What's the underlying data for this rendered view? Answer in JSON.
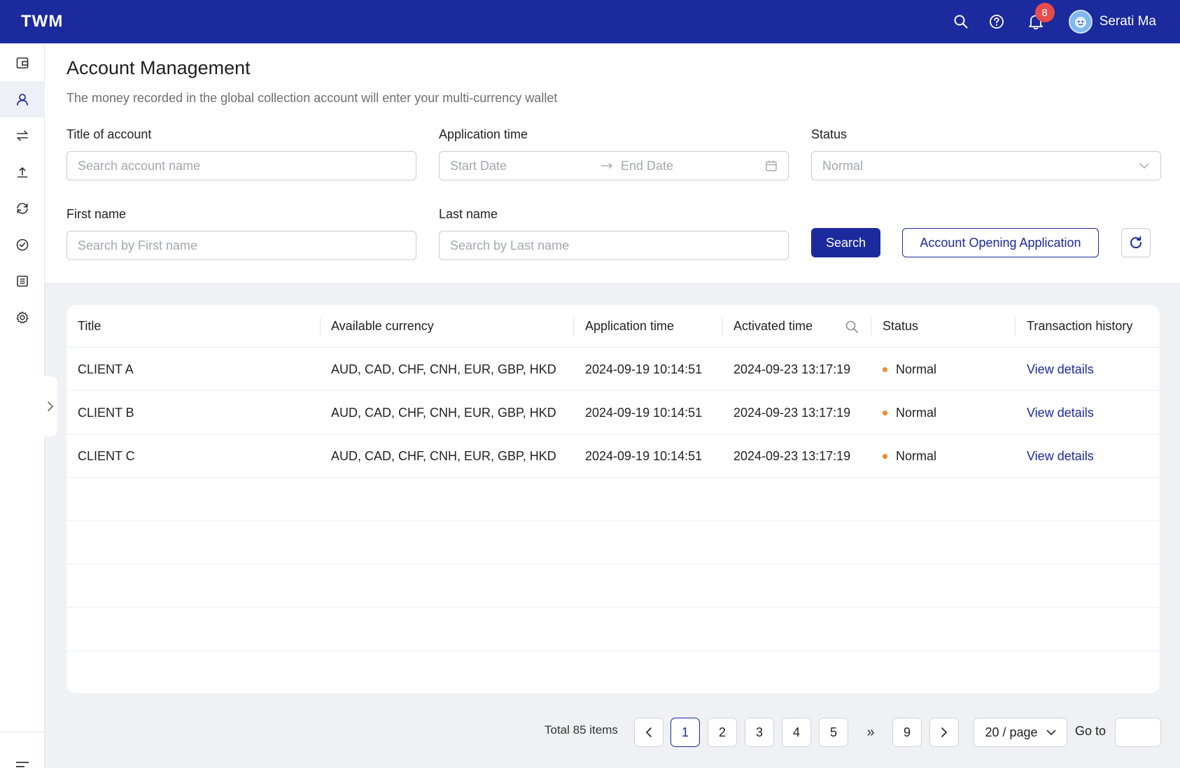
{
  "header": {
    "logo": "TWM",
    "notification_count": "8",
    "user_name": "Serati Ma"
  },
  "sidebar": {
    "items": [
      {
        "icon": "wallet-icon"
      },
      {
        "icon": "user-icon",
        "active": true
      },
      {
        "icon": "transfer-icon"
      },
      {
        "icon": "upload-icon"
      },
      {
        "icon": "refresh-cycle-icon"
      },
      {
        "icon": "check-circle-icon"
      },
      {
        "icon": "list-icon"
      },
      {
        "icon": "gear-icon"
      }
    ]
  },
  "page": {
    "title": "Account Management",
    "subtitle": "The money recorded in the global collection account will enter your multi-currency wallet"
  },
  "filters": {
    "title_label": "Title of account",
    "title_placeholder": "Search account name",
    "app_time_label": "Application time",
    "start_placeholder": "Start Date",
    "end_placeholder": "End Date",
    "status_label": "Status",
    "status_value": "Normal",
    "first_label": "First name",
    "first_placeholder": "Search by First name",
    "last_label": "Last name",
    "last_placeholder": "Search by Last name",
    "search_btn": "Search",
    "open_btn": "Account Opening Application"
  },
  "table": {
    "columns": [
      "Title",
      "Available currency",
      "Application time",
      "Activated time",
      "Status",
      "Transaction history"
    ],
    "rows": [
      {
        "title": "CLIENT A",
        "currency": "AUD, CAD, CHF, CNH, EUR, GBP, HKD",
        "app_time": "2024-09-19 10:14:51",
        "act_time": "2024-09-23 13:17:19",
        "status": "Normal",
        "history": "View details"
      },
      {
        "title": "CLIENT B",
        "currency": "AUD, CAD, CHF, CNH, EUR, GBP, HKD",
        "app_time": "2024-09-19 10:14:51",
        "act_time": "2024-09-23 13:17:19",
        "status": "Normal",
        "history": "View details"
      },
      {
        "title": "CLIENT C",
        "currency": "AUD, CAD, CHF, CNH, EUR, GBP, HKD",
        "app_time": "2024-09-19 10:14:51",
        "act_time": "2024-09-23 13:17:19",
        "status": "Normal",
        "history": "View details"
      }
    ]
  },
  "pagination": {
    "total": "Total 85 items",
    "pages": [
      "1",
      "2",
      "3",
      "4",
      "5",
      "9"
    ],
    "current": "1",
    "ellipsis": "»",
    "page_size": "20 / page",
    "goto_label": "Go to"
  },
  "colors": {
    "brand": "#1b2a9c",
    "status_dot": "#f08a2e",
    "badge": "#e84c4c"
  }
}
